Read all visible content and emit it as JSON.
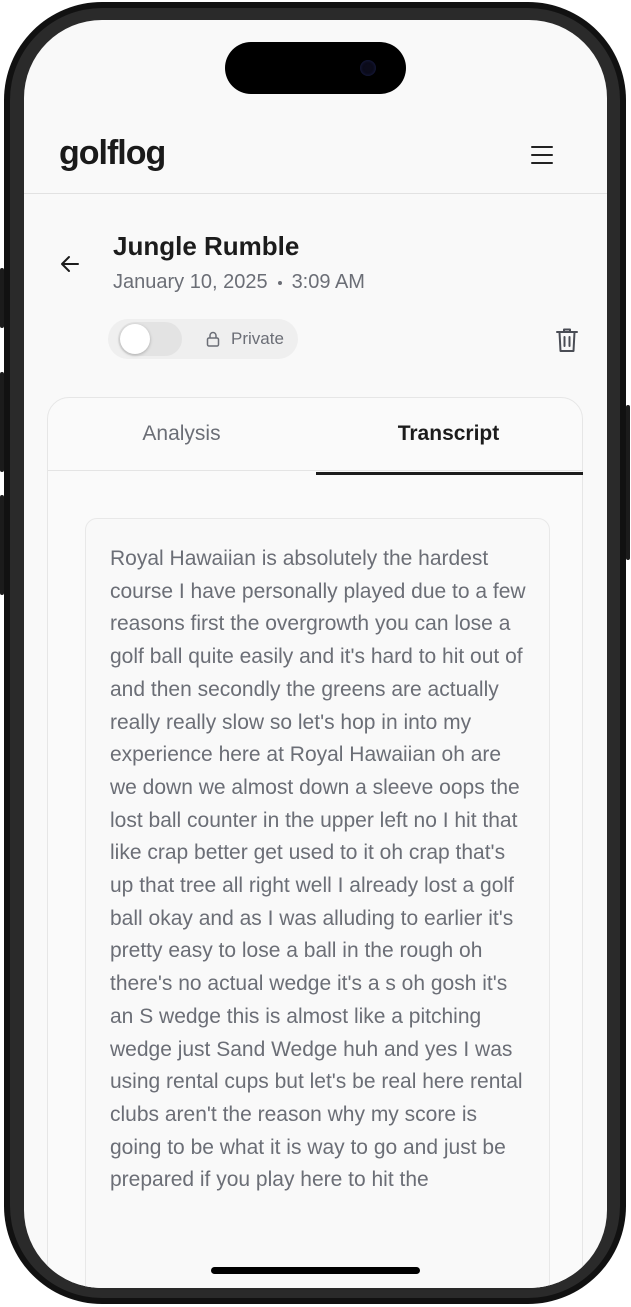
{
  "app": {
    "logo": "golflog"
  },
  "header": {
    "menu_icon": "hamburger-menu-icon"
  },
  "round": {
    "title": "Jungle Rumble",
    "date": "January 10, 2025",
    "time": "3:09 AM",
    "visibility_label": "Private",
    "is_public": false
  },
  "tabs": [
    {
      "label": "Analysis",
      "active": false
    },
    {
      "label": "Transcript",
      "active": true
    }
  ],
  "transcript": {
    "text": "Royal Hawaiian is absolutely the hardest course I have personally played due to a few reasons first the overgrowth you can lose a golf ball quite easily and it's hard to hit out of and then secondly the greens are actually really really slow so let's hop in into my experience here at Royal Hawaiian oh are we down we almost down a sleeve oops the lost ball counter in the upper left no I hit that like crap better get used to it oh crap that's up that tree all right well I already lost a golf ball okay and as I was alluding to earlier it's pretty easy to lose a ball in the rough oh there's no actual wedge it's a s oh gosh it's an S wedge this is almost like a pitching wedge just Sand Wedge huh and yes I was using rental cups but let's be real here rental clubs aren't the reason why my score is going to be what it is way to go and just be prepared if you play here to hit the"
  },
  "colors": {
    "text_primary": "#1c1c1c",
    "text_secondary": "#6b6e76",
    "background": "#f9f9f9"
  }
}
